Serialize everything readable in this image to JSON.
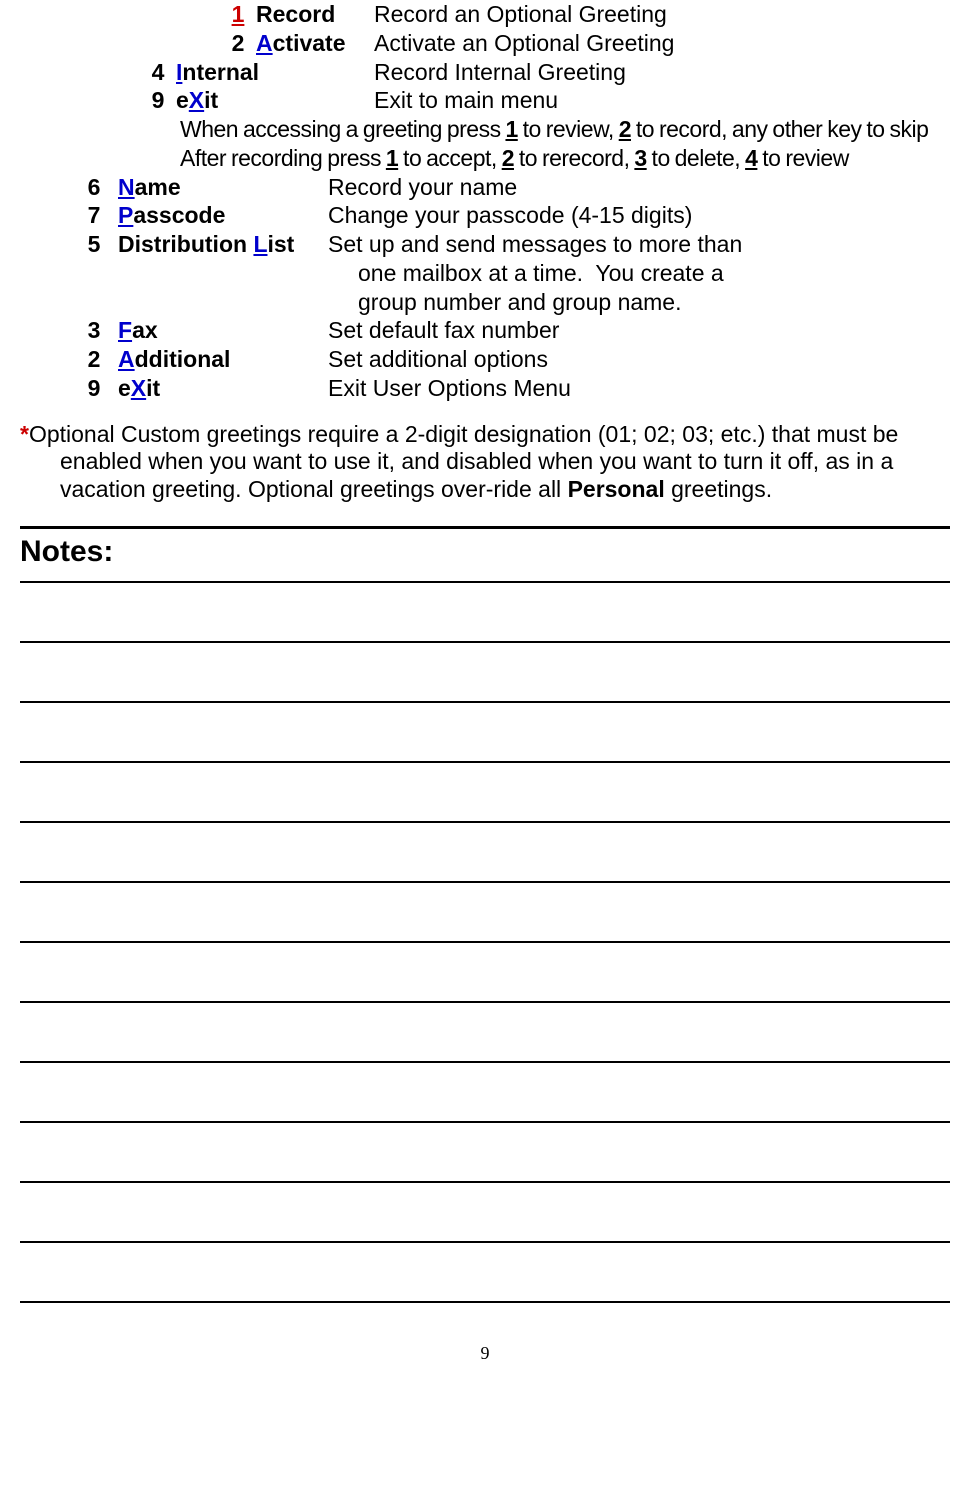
{
  "sub1": [
    {
      "num": "1",
      "hot": "1",
      "rest": "",
      "name": "Record",
      "desc": "Record an Optional Greeting",
      "hotstyle": "hot1"
    },
    {
      "num": "2",
      "hot": "A",
      "rest": "ctivate",
      "name": "",
      "desc": "Activate an Optional Greeting",
      "hotstyle": "hot"
    }
  ],
  "sub2": [
    {
      "num": "4",
      "hot": "I",
      "rest": "nternal",
      "desc": "Record Internal Greeting",
      "hotstyle": "hot"
    },
    {
      "num": "9",
      "pre": "e",
      "hot": "X",
      "rest": "it",
      "desc": "Exit to main menu",
      "hotstyle": "hot"
    }
  ],
  "instr1_parts": [
    "When accessing a greeting press ",
    "1",
    " to review, ",
    "2",
    " to record, any other key to skip"
  ],
  "instr2_parts": [
    "After recording press ",
    "1",
    " to accept, ",
    "2",
    " to rerecord, ",
    "3",
    " to delete, ",
    "4",
    " to review"
  ],
  "main": [
    {
      "num": "6",
      "hot": "N",
      "rest": "ame",
      "desc": "Record your name",
      "hotstyle": "hot"
    },
    {
      "num": "7",
      "hot": "P",
      "rest": "asscode",
      "desc": "Change your passcode (4-15 digits)",
      "hotstyle": "hot"
    },
    {
      "num": "5",
      "pre": "Distribution ",
      "hot": "L",
      "rest": "ist",
      "desc": "Set up and send messages to more than one mailbox at a time.  You create a group number and group name.",
      "hotstyle": "hot",
      "multi": true
    },
    {
      "num": "3",
      "hot": "F",
      "rest": "ax",
      "desc": " Set default fax number",
      "hotstyle": "hot"
    },
    {
      "num": "2",
      "hot": "A",
      "rest": "dditional",
      "desc": "Set additional options",
      "hotstyle": "hot"
    },
    {
      "num": "9",
      "pre": "e",
      "hot": "X",
      "rest": "it",
      "desc": "Exit User Options Menu",
      "hotstyle": "hot"
    }
  ],
  "footnote_star": "*",
  "footnote_a": "Optional Custom greetings require a 2-digit designation (01; 02; 03; etc.) that must be enabled when you want to use it, and disabled when you want to turn it off, as in a vacation greeting.  Optional greetings over-ride all ",
  "footnote_bold": "Personal",
  "footnote_b": " greetings.",
  "notes_label": "Notes:",
  "note_lines": 12,
  "page_number": "9"
}
